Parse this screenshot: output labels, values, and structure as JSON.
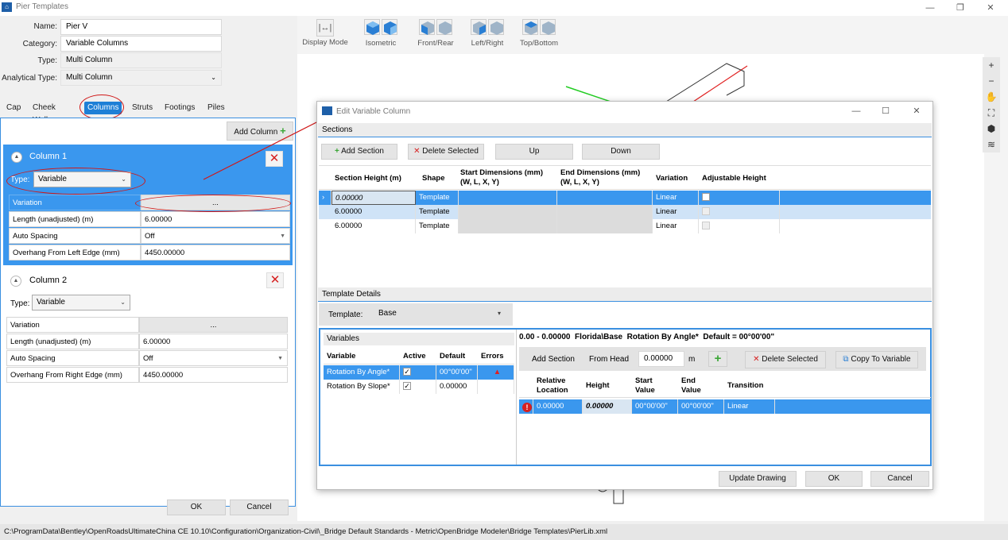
{
  "window": {
    "title": "Pier Templates"
  },
  "form": {
    "name_label": "Name:",
    "name_value": "Pier V",
    "category_label": "Category:",
    "category_value": "Variable Columns",
    "type_label": "Type:",
    "type_value": "Multi Column",
    "analytical_label": "Analytical Type:",
    "analytical_value": "Multi Column"
  },
  "tabs": [
    "Cap",
    "Cheek Walls",
    "Columns",
    "Struts",
    "Footings",
    "Piles"
  ],
  "columns_panel": {
    "add_label": "Add Column",
    "columns": [
      {
        "title": "Column 1",
        "type_label": "Type:",
        "type_value": "Variable",
        "rows": [
          [
            "Variation",
            "..."
          ],
          [
            "Length (unadjusted) (m)",
            "6.00000"
          ],
          [
            "Auto Spacing",
            "Off"
          ],
          [
            "Overhang From Left Edge (mm)",
            "4450.00000"
          ]
        ]
      },
      {
        "title": "Column 2",
        "type_label": "Type:",
        "type_value": "Variable",
        "rows": [
          [
            "Variation",
            "..."
          ],
          [
            "Length (unadjusted) (m)",
            "6.00000"
          ],
          [
            "Auto Spacing",
            "Off"
          ],
          [
            "Overhang From Right Edge (mm)",
            "4450.00000"
          ]
        ]
      }
    ]
  },
  "footer": {
    "ok": "OK",
    "cancel": "Cancel"
  },
  "toolbar": {
    "display_mode": "Display Mode",
    "isometric": "Isometric",
    "front_rear": "Front/Rear",
    "left_right": "Left/Right",
    "top_bottom": "Top/Bottom"
  },
  "dialog": {
    "title": "Edit Variable Column",
    "sections_label": "Sections",
    "add_section": "Add Section",
    "delete_selected": "Delete Selected",
    "up": "Up",
    "down": "Down",
    "headers": [
      "Section Height (m)",
      "Shape",
      "Start Dimensions (mm)\n(W, L, X, Y)",
      "End Dimensions (mm)\n(W, L, X, Y)",
      "Variation",
      "Adjustable Height"
    ],
    "rows": [
      {
        "height": "0.00000",
        "shape": "Template",
        "variation": "Linear",
        "adjustable": true
      },
      {
        "height": "6.00000",
        "shape": "Template",
        "variation": "Linear",
        "adjustable": false
      },
      {
        "height": "6.00000",
        "shape": "Template",
        "variation": "Linear",
        "adjustable": false
      }
    ],
    "template_details_label": "Template Details",
    "template_label": "Template:",
    "template_value": "Base",
    "variables_label": "Variables",
    "var_headers": [
      "Variable",
      "Active",
      "Default",
      "Errors"
    ],
    "variables": [
      {
        "name": "Rotation By Angle*",
        "default": "00°00'00\""
      },
      {
        "name": "Rotation By Slope*",
        "default": "0.00000"
      }
    ],
    "detail_title": "0.00 - 0.00000  Florida\\Base  Rotation By Angle*  Default = 00°00'00\"",
    "detail_add_section": "Add Section",
    "from_head": "From Head",
    "from_head_value": "0.00000",
    "unit_m": "m",
    "detail_delete": "Delete Selected",
    "copy_to_variable": "Copy To Variable",
    "detail_headers": [
      "Relative\nLocation",
      "Height",
      "Start\nValue",
      "End\nValue",
      "Transition"
    ],
    "detail_row": {
      "location": "0.00000",
      "height": "0.00000",
      "start": "00°00'00\"",
      "end": "00°00'00\"",
      "transition": "Linear"
    },
    "update_drawing": "Update Drawing",
    "ok": "OK",
    "cancel": "Cancel"
  },
  "status_path": "C:\\ProgramData\\Bentley\\OpenRoadsUltimateChina CE 10.10\\Configuration\\Organization-Civil\\_Bridge Default Standards - Metric\\OpenBridge Modeler\\Bridge Templates\\PierLib.xml"
}
